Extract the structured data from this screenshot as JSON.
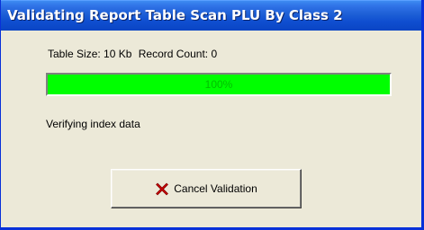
{
  "window": {
    "title": "Validating Report Table Scan PLU By Class 2"
  },
  "info": {
    "table_size": "Table Size: 10 Kb",
    "record_count": "Record Count: 0"
  },
  "progress": {
    "percent": 100,
    "label": "100%",
    "fill_color": "#00ff00"
  },
  "status": {
    "text": "Verifying index data"
  },
  "cancel_button": {
    "label": "Cancel Validation",
    "icon": "red-x-icon"
  }
}
